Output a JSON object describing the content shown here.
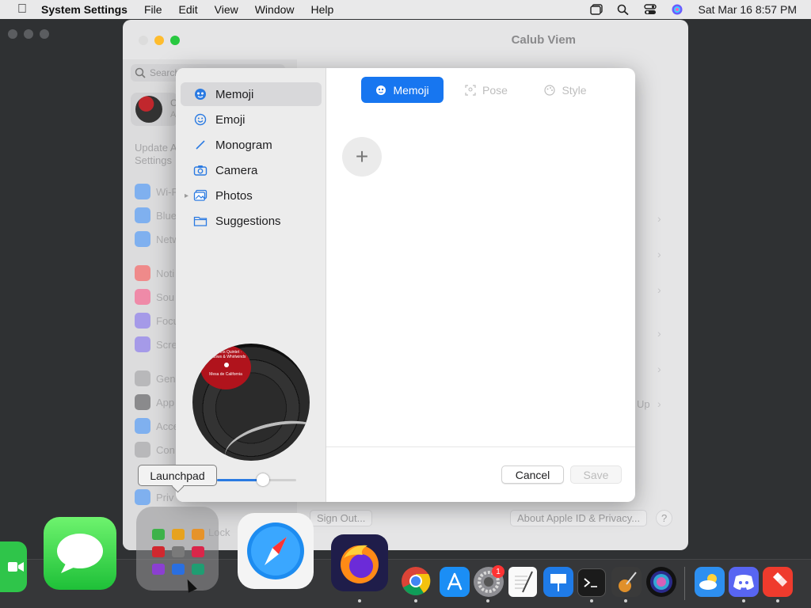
{
  "menubar": {
    "app_name": "System Settings",
    "menus": [
      "File",
      "Edit",
      "View",
      "Window",
      "Help"
    ],
    "datetime": "Sat Mar 16  8:57 PM"
  },
  "settings_window": {
    "title": "Calub Viem",
    "search_placeholder": "Search",
    "profile_initial": "C",
    "profile_line2": "A",
    "update_text_1": "Update A",
    "update_text_2": "Settings",
    "sidebar_items": [
      "Wi-F",
      "Blue",
      "Netw",
      "Noti",
      "Sou",
      "Focu",
      "Scre",
      "Gen",
      "App",
      "Acce",
      "Con",
      "Priv"
    ],
    "sign_out": "Sign Out...",
    "about_apple_id": "About Apple ID & Privacy...",
    "help": "?",
    "up_text": "Up",
    "lock_text": "Lock"
  },
  "modal": {
    "nav": [
      {
        "label": "Memoji",
        "icon": "memoji-icon"
      },
      {
        "label": "Emoji",
        "icon": "emoji-icon"
      },
      {
        "label": "Monogram",
        "icon": "monogram-icon"
      },
      {
        "label": "Camera",
        "icon": "camera-icon"
      },
      {
        "label": "Photos",
        "icon": "photos-icon"
      },
      {
        "label": "Suggestions",
        "icon": "folder-icon"
      }
    ],
    "active_nav": "Memoji",
    "tabs": [
      {
        "label": "Memoji",
        "active": true
      },
      {
        "label": "Pose",
        "active": false
      },
      {
        "label": "Style",
        "active": false
      }
    ],
    "add_symbol": "+",
    "cancel_label": "Cancel",
    "save_label": "Save",
    "zoom_level": 0.58,
    "record_label_top": "Fine Arts Quintet · Shadows & Whirlwinds",
    "record_label_bottom": "Mesa de California"
  },
  "tooltip": "Launchpad",
  "dock": {
    "apps": [
      "FaceTime",
      "Messages",
      "Launchpad",
      "Safari",
      "Firefox",
      "Chrome",
      "App Store",
      "System Settings",
      "TextEdit",
      "Keynote",
      "Terminal",
      "GarageBand",
      "Siri",
      "Weather",
      "Discord",
      "AnyDesk"
    ],
    "badge_count": "1"
  },
  "colors": {
    "accent": "#1776f0",
    "close": "#ff5f57",
    "minimize": "#febc2e",
    "zoom": "#28c840"
  }
}
